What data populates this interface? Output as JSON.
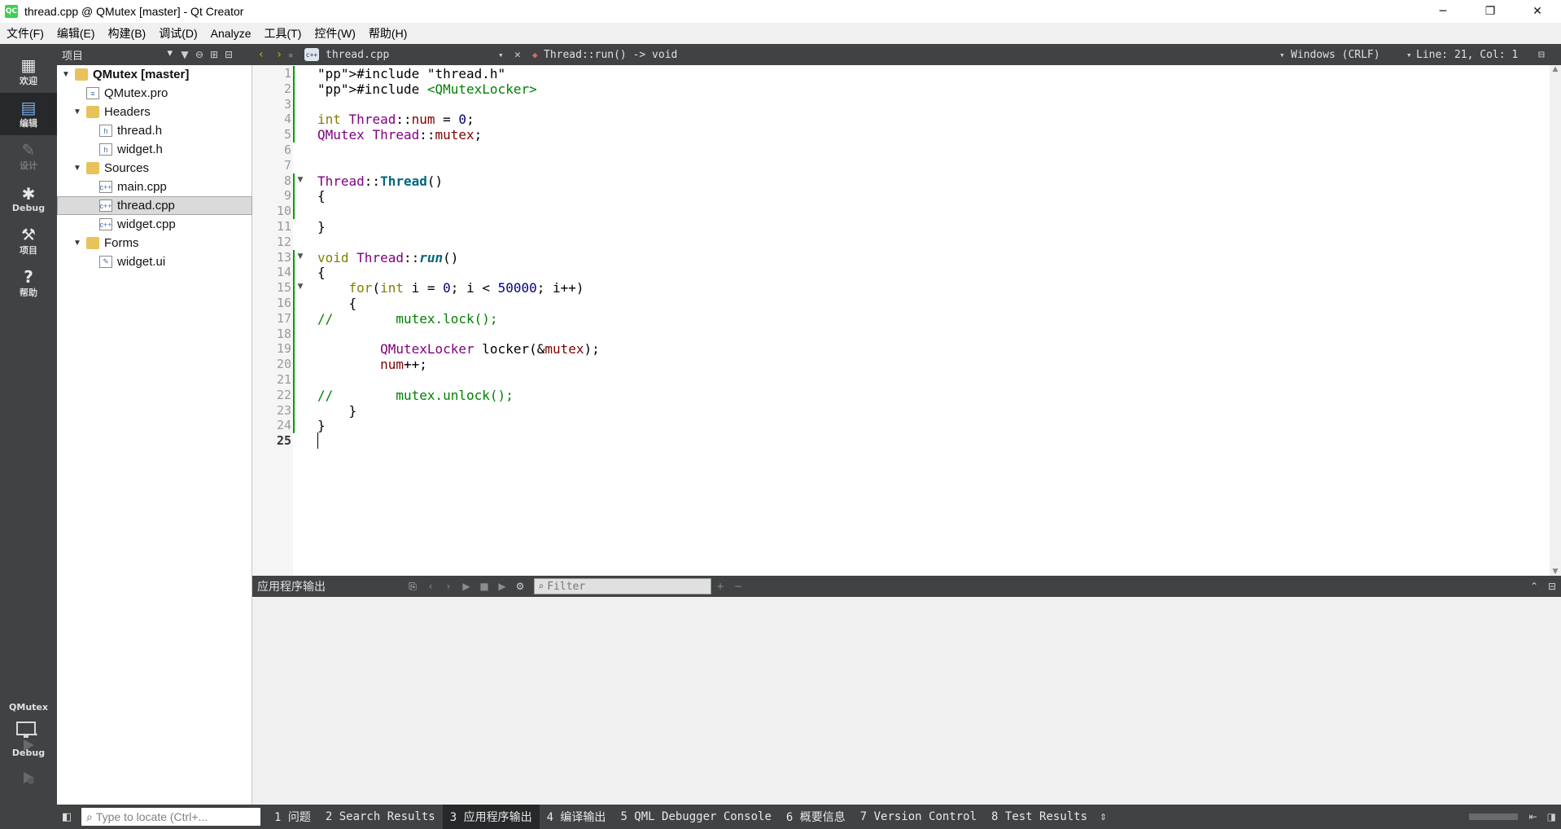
{
  "window": {
    "app_icon": "QC",
    "title": "thread.cpp @ QMutex [master] - Qt Creator",
    "controls": {
      "minimize": "─",
      "restore": "❐",
      "close": "✕"
    }
  },
  "menu": [
    "文件(F)",
    "编辑(E)",
    "构建(B)",
    "调试(D)",
    "Analyze",
    "工具(T)",
    "控件(W)",
    "帮助(H)"
  ],
  "modes": [
    {
      "label": "欢迎",
      "icon": "grid-icon",
      "glyph": "▦"
    },
    {
      "label": "编辑",
      "icon": "edit-icon",
      "glyph": "▤"
    },
    {
      "label": "设计",
      "icon": "design-icon",
      "glyph": "✎"
    },
    {
      "label": "Debug",
      "icon": "bug-icon",
      "glyph": "✱"
    },
    {
      "label": "项目",
      "icon": "wrench-icon",
      "glyph": "⚒"
    },
    {
      "label": "帮助",
      "icon": "help-icon",
      "glyph": "?"
    }
  ],
  "kit": {
    "project": "QMutex",
    "config": "Debug"
  },
  "project_panel": {
    "title": "项目",
    "tree": [
      {
        "label": "QMutex [master]",
        "bold": true,
        "kind": "project"
      },
      {
        "label": "QMutex.pro",
        "kind": "pro"
      },
      {
        "label": "Headers",
        "kind": "folder"
      },
      {
        "label": "thread.h",
        "kind": "h"
      },
      {
        "label": "widget.h",
        "kind": "h"
      },
      {
        "label": "Sources",
        "kind": "folder"
      },
      {
        "label": "main.cpp",
        "kind": "cpp"
      },
      {
        "label": "thread.cpp",
        "kind": "cpp",
        "selected": true
      },
      {
        "label": "widget.cpp",
        "kind": "cpp"
      },
      {
        "label": "Forms",
        "kind": "folder"
      },
      {
        "label": "widget.ui",
        "kind": "ui"
      }
    ]
  },
  "editor_toolbar": {
    "file": "thread.cpp",
    "symbol": "Thread::run() -> void",
    "encoding": "Windows (CRLF)",
    "position": "Line: 21, Col: 1"
  },
  "editor": {
    "current_line": 25,
    "lines": [
      "#include \"thread.h\"",
      "#include <QMutexLocker>",
      "",
      "int Thread::num = 0;",
      "QMutex Thread::mutex;",
      "",
      "",
      "Thread::Thread()",
      "{",
      "",
      "}",
      "",
      "void Thread::run()",
      "{",
      "    for(int i = 0; i < 50000; i++)",
      "    {",
      "//        mutex.lock();",
      "",
      "        QMutexLocker locker(&mutex);",
      "        num++;",
      "",
      "//        mutex.unlock();",
      "    }",
      "}",
      ""
    ]
  },
  "output_pane": {
    "title": "应用程序输出",
    "filter_placeholder": "Filter"
  },
  "bottom_bar": {
    "locator_placeholder": "Type to locate (Ctrl+...",
    "tabs": [
      "1 问题",
      "2 Search Results",
      "3 应用程序输出",
      "4 编译输出",
      "5 QML Debugger Console",
      "6 概要信息",
      "7 Version Control",
      "8 Test Results"
    ]
  }
}
